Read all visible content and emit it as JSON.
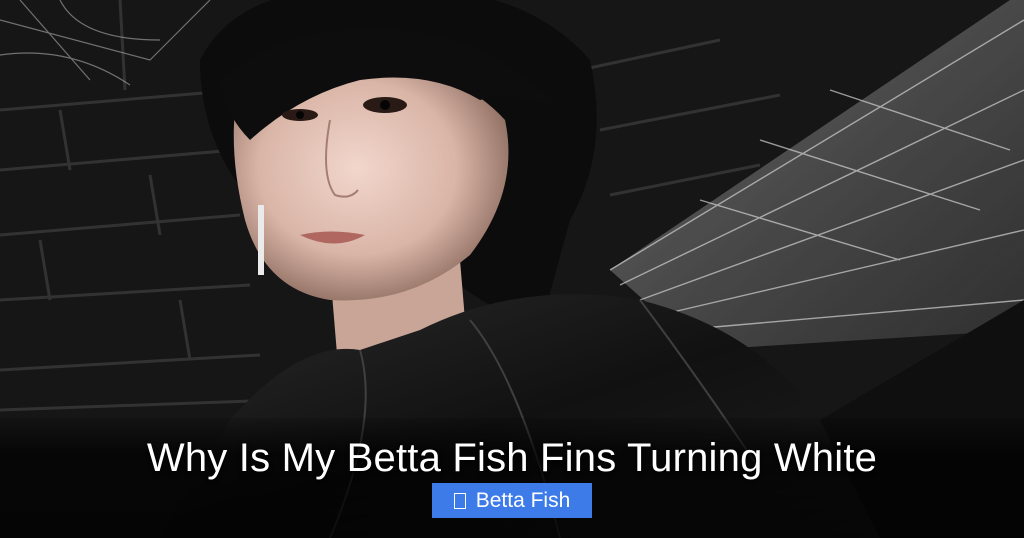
{
  "post": {
    "title": "Why Is My Betta Fish Fins Turning White",
    "category": {
      "label": "Betta Fish",
      "icon": "folder-icon",
      "color": "#3d7be8"
    }
  },
  "colors": {
    "background": "#141414",
    "title_text": "#ffffff"
  }
}
